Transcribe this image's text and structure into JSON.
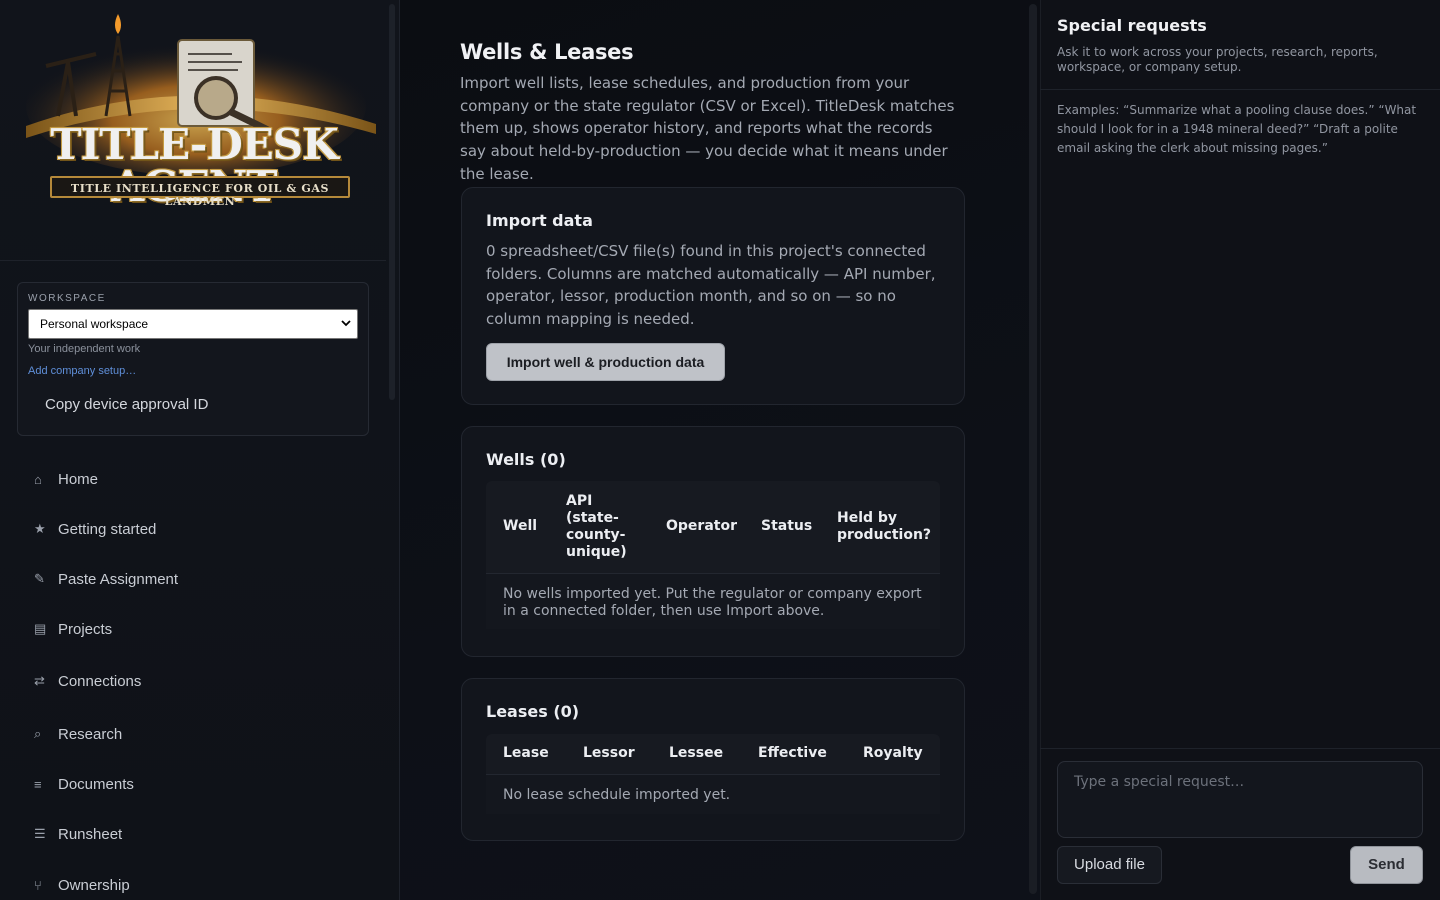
{
  "logo": {
    "title": "TITLE-DESK AGENT",
    "tagline": "TITLE INTELLIGENCE FOR OIL & GAS LANDMEN"
  },
  "workspace": {
    "label": "WORKSPACE",
    "selected": "Personal workspace",
    "hint": "Your independent work",
    "add_company_link": "Add company setup…",
    "copy_device_button": "Copy device approval ID"
  },
  "nav": [
    {
      "icon": "⌂",
      "label": "Home"
    },
    {
      "icon": "★",
      "label": "Getting started"
    },
    {
      "icon": "✎",
      "label": "Paste Assignment"
    },
    {
      "icon": "▤",
      "label": "Projects"
    },
    {
      "icon": "⇄",
      "label": "Connections"
    },
    {
      "icon": "⌕",
      "label": "Research"
    },
    {
      "icon": "≡",
      "label": "Documents"
    },
    {
      "icon": "☰",
      "label": "Runsheet"
    },
    {
      "icon": "⑂",
      "label": "Ownership"
    }
  ],
  "page": {
    "title": "Wells & Leases",
    "description": "Import well lists, lease schedules, and production from your company or the state regulator (CSV or Excel). TitleDesk matches them up, shows operator history, and reports what the records say about held-by-production — you decide what it means under the lease."
  },
  "import_card": {
    "title": "Import data",
    "text": "0 spreadsheet/CSV file(s) found in this project's connected folders. Columns are matched automatically — API number, operator, lessor, production month, and so on — so no column mapping is needed.",
    "button": "Import well & production data"
  },
  "wells_card": {
    "title": "Wells (0)",
    "columns": [
      "Well",
      "API (state-county-unique)",
      "Operator",
      "Status",
      "Held by production?"
    ],
    "column_lines": [
      [
        "Well"
      ],
      [
        "API",
        "(state-",
        "county-",
        "unique)"
      ],
      [
        "Operator"
      ],
      [
        "Status"
      ],
      [
        "Held by",
        "production?"
      ]
    ],
    "empty": "No wells imported yet. Put the regulator or company export in a connected folder, then use Import above."
  },
  "leases_card": {
    "title": "Leases (0)",
    "columns": [
      "Lease",
      "Lessor",
      "Lessee",
      "Effective",
      "Royalty"
    ],
    "empty": "No lease schedule imported yet."
  },
  "special_requests": {
    "title": "Special requests",
    "subtitle": "Ask it to work across your projects, research, reports, workspace, or company setup.",
    "examples": "Examples: “Summarize what a pooling clause does.” “What should I look for in a 1948 mineral deed?” “Draft a polite email asking the clerk about missing pages.”",
    "input_placeholder": "Type a special request…",
    "upload_button": "Upload file",
    "send_button": "Send"
  }
}
